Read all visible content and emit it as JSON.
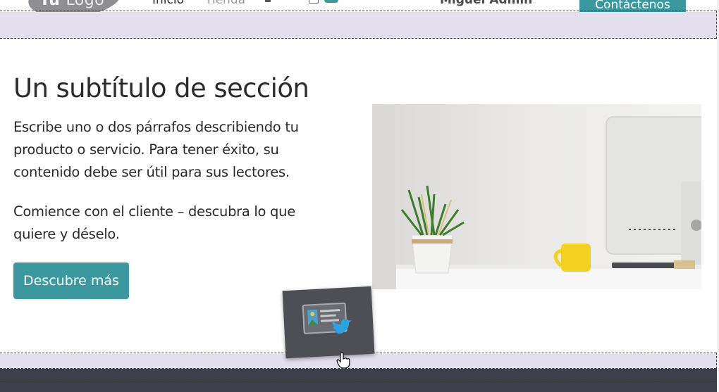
{
  "navbar": {
    "logo_text_bold": "Tu",
    "logo_text_light": "Logo",
    "links": [
      "Inicio",
      "Tienda"
    ],
    "user": "Miguel Admin",
    "contact_button": "Contáctenos"
  },
  "section": {
    "subtitle": "Un subtítulo de sección",
    "paragraph_1": "Escribe uno o dos párrafos describiendo tu producto o servicio. Para tener éxito, su contenido debe ser útil para sus lectores.",
    "paragraph_2": "Comience con el cliente – descubra lo que quiere y déselo.",
    "cta_label": "Descubre más"
  },
  "drag_snippet": {
    "icon": "social-media-snippet-icon"
  },
  "colors": {
    "accent": "#3a989e",
    "dropzone": "#e3dfec",
    "footer": "#3d3f4a",
    "snippet": "#4e4f55"
  }
}
